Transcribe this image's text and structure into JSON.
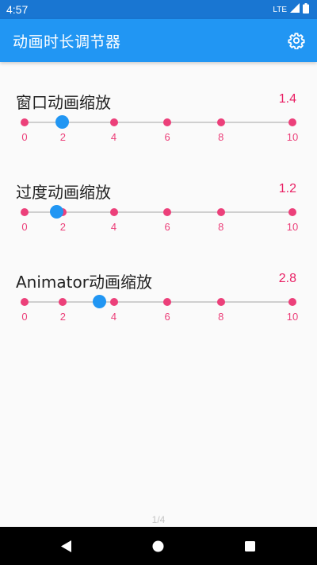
{
  "status": {
    "time": "4:57",
    "network": "LTE"
  },
  "appbar": {
    "title": "动画时长调节器"
  },
  "sliders": [
    {
      "label": "窗口动画缩放",
      "value_text": "1.4",
      "value": 1.4
    },
    {
      "label": "过度动画缩放",
      "value_text": "1.2",
      "value": 1.2
    },
    {
      "label": "Animator动画缩放",
      "value_text": "2.8",
      "value": 2.8
    }
  ],
  "scale": {
    "min": 0,
    "max": 10,
    "ticks": [
      0,
      1.43,
      3.33,
      5.33,
      7.33,
      10
    ],
    "labels": [
      "0",
      "2",
      "4",
      "6",
      "8",
      "10"
    ]
  },
  "pager": {
    "text": "1/4"
  },
  "colors": {
    "primary": "#2196f3",
    "primary_dark": "#1976d2",
    "accent": "#e91e63",
    "tick": "#ec407a"
  },
  "icons": {
    "settings": "gear-icon",
    "back": "back-triangle-icon",
    "home": "home-circle-icon",
    "recent": "recent-square-icon"
  }
}
